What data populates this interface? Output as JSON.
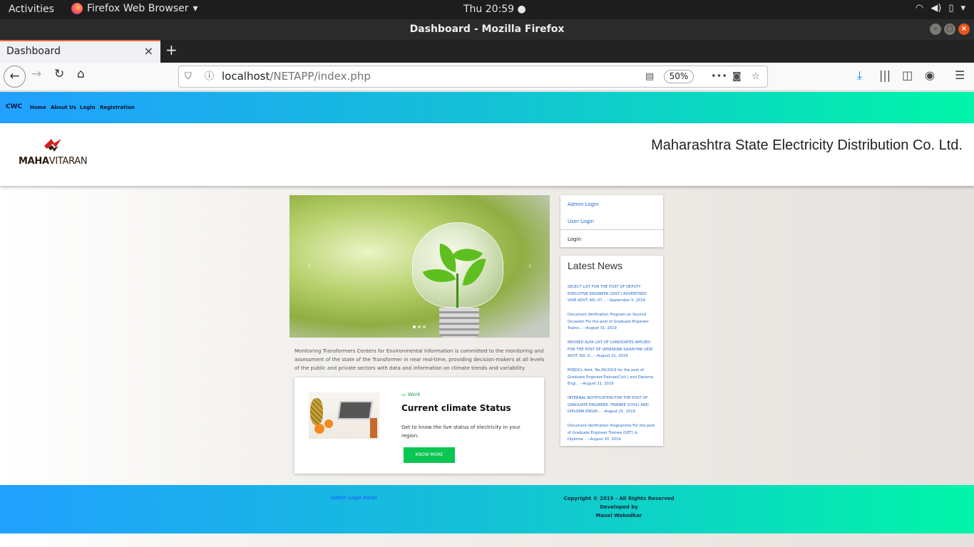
{
  "system": {
    "activities": "Activities",
    "app_name": "Firefox Web Browser",
    "clock": "Thu 20:59"
  },
  "window": {
    "title": "Dashboard - Mozilla Firefox"
  },
  "tab": {
    "title": "Dashboard",
    "close": "×",
    "new": "+"
  },
  "url": {
    "host": "localhost",
    "path": "/NETAPP/index.php",
    "zoom": "50%"
  },
  "site": {
    "brand": "CWC",
    "nav": [
      "Home",
      "About Us",
      "Login",
      "Registration"
    ],
    "logo": {
      "bold": "MAHA",
      "rest": "VITARAN"
    },
    "company": "Maharashtra State Electricity Distribution Co. Ltd.",
    "carousel": {
      "prev": "‹",
      "next": "›"
    },
    "intro": "Monitoring Transformers Centers for Environmental Information is committed to the monitoring and assessment of the state of the Transformer in near real-time, providing decision-makers at all levels of the public and private sectors with data and information on climate trends and variability.",
    "card": {
      "tag": "Work",
      "title": "Current climate Status",
      "desc": "Get to know the live status of electricity in your region.",
      "button": "KNOW MORE"
    },
    "login_box": {
      "admin": "Admin Login",
      "user": "User Login",
      "footer": "Login"
    },
    "news": {
      "title": "Latest News",
      "items": [
        "SELECT LIST FOR THE POST OF DEPUTY EXECUTIVE ENGINEER (DIST.) ADVERTISED VIDE ADVT. NO. 07... --September 5, 2019",
        "Document Verification Program on Second Occasion For the post of Graduate Engineer Traine... --August 31, 2019",
        "REVISED ALFA LIST OF CANDIDATES APPLIED FOR THE POST OF UPKENDRA SAHAYYAK VIDE ADVT. NO. 0... --August 21, 2019",
        "MSEDCL Advt. No.06/2019 for the post of Graduate Engineer-Trainee(Civil ) and Diploma Engi... --August 21, 2019",
        "INTERNAL NOTIFICATION FOR THE POST OF GRADUATE ENGINEER -TRAINEE (CIVIL) AND DIPLOMA ENGIN... --August 21, 2019",
        "Document Verification Programme For the post of Graduate Engineer Trainee (GET) & Diploma... --August 20, 2019"
      ]
    },
    "footer": {
      "admin_panel": "Admin Login Panel",
      "copyright": "Copyright © 2019 - All Rights Reserved",
      "developed": "Developed by",
      "author": "Mansi Wakodkar"
    }
  }
}
